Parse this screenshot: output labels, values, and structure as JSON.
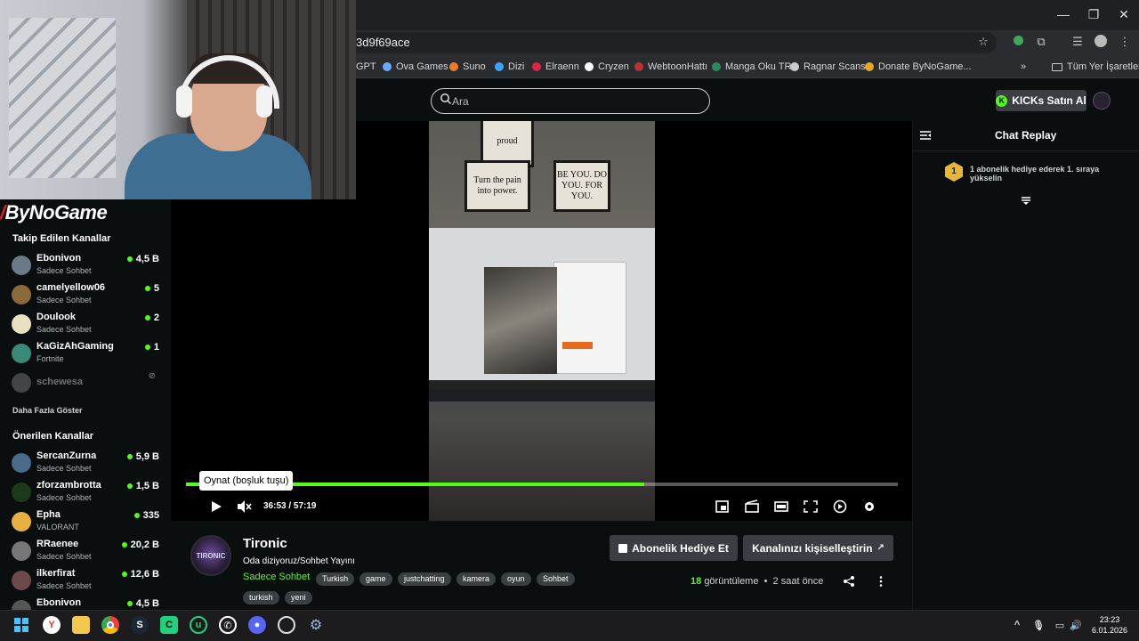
{
  "browser": {
    "url": "3d9f69ace",
    "bookmarks": [
      "GPT",
      "Ova Games",
      "Suno",
      "Dizi",
      "Elraenn",
      "Cryzen",
      "WebtoonHattı",
      "Manga Oku TR",
      "Ragnar Scans",
      "Donate ByNoGame..."
    ],
    "bookmark_colors": [
      "#999999",
      "#6aa9ff",
      "#f07a2a",
      "#3aa3ff",
      "#e0244a",
      "#ffffff",
      "#bb3333",
      "#2c8a5a",
      "#cccccc",
      "#e5a823"
    ],
    "all_bookmarks_label": "Tüm Yer İşaretleri",
    "more_label": "»"
  },
  "header": {
    "search_placeholder": "Ara",
    "kicks_label": "KICKs Satın Al"
  },
  "sidebar": {
    "logo": "ByNoGame",
    "followed_title": "Takip Edilen Kanallar",
    "followed": [
      {
        "name": "Ebonivon",
        "sub": "Sadece Sohbet",
        "count": "4,5 B",
        "live": true
      },
      {
        "name": "camelyellow06",
        "sub": "Sadece Sohbet",
        "count": "5",
        "live": true
      },
      {
        "name": "Doulook",
        "sub": "Sadece Sohbet",
        "count": "2",
        "live": true
      },
      {
        "name": "KaGizAhGaming",
        "sub": "Fortnite",
        "count": "1",
        "live": true
      },
      {
        "name": "schewesa",
        "sub": "",
        "count": "",
        "live": false
      }
    ],
    "show_more": "Daha Fazla Göster",
    "recommended_title": "Önerilen Kanallar",
    "recommended": [
      {
        "name": "SercanZurna",
        "sub": "Sadece Sohbet",
        "count": "5,9 B"
      },
      {
        "name": "zforzambrotta",
        "sub": "Sadece Sohbet",
        "count": "1,5 B"
      },
      {
        "name": "Epha",
        "sub": "VALORANT",
        "count": "335"
      },
      {
        "name": "RRaenee",
        "sub": "Sadece Sohbet",
        "count": "20,2 B"
      },
      {
        "name": "ilkerfirat",
        "sub": "Sadece Sohbet",
        "count": "12,6 B"
      },
      {
        "name": "Ebonivon",
        "sub": "",
        "count": "4,5 B"
      }
    ]
  },
  "player": {
    "tooltip": "Oynat (boşluk tuşu)",
    "time": "36:53 / 57:19",
    "progress_fraction": 0.644,
    "poster_texts": [
      "proud",
      "Turn the pain into power.",
      "BE YOU. DO YOU. FOR YOU."
    ]
  },
  "stream": {
    "avatar_text": "TIRONIC",
    "name": "Tironic",
    "title": "Oda diziyoruz/Sohbet Yayını",
    "category": "Sadece Sohbet",
    "tags": [
      "Turkish",
      "game",
      "justchatting",
      "kamera",
      "oyun",
      "Sohbet"
    ],
    "tags2": [
      "turkish",
      "yeni"
    ],
    "gift_button": "Abonelik Hediye Et",
    "customize_button": "Kanalınızı kişiselleştirin",
    "views_count": "18",
    "views_label": "görüntüleme",
    "ago": "2 saat önce"
  },
  "chat": {
    "title": "Chat Replay",
    "rank": "1",
    "gift_message": "1 abonelik hediye ederek 1. sıraya yükselin"
  },
  "taskbar": {
    "time": "23:23",
    "date": "6.01.2026"
  },
  "colors": {
    "accent": "#53fc18",
    "background": "#0b0e0f"
  }
}
